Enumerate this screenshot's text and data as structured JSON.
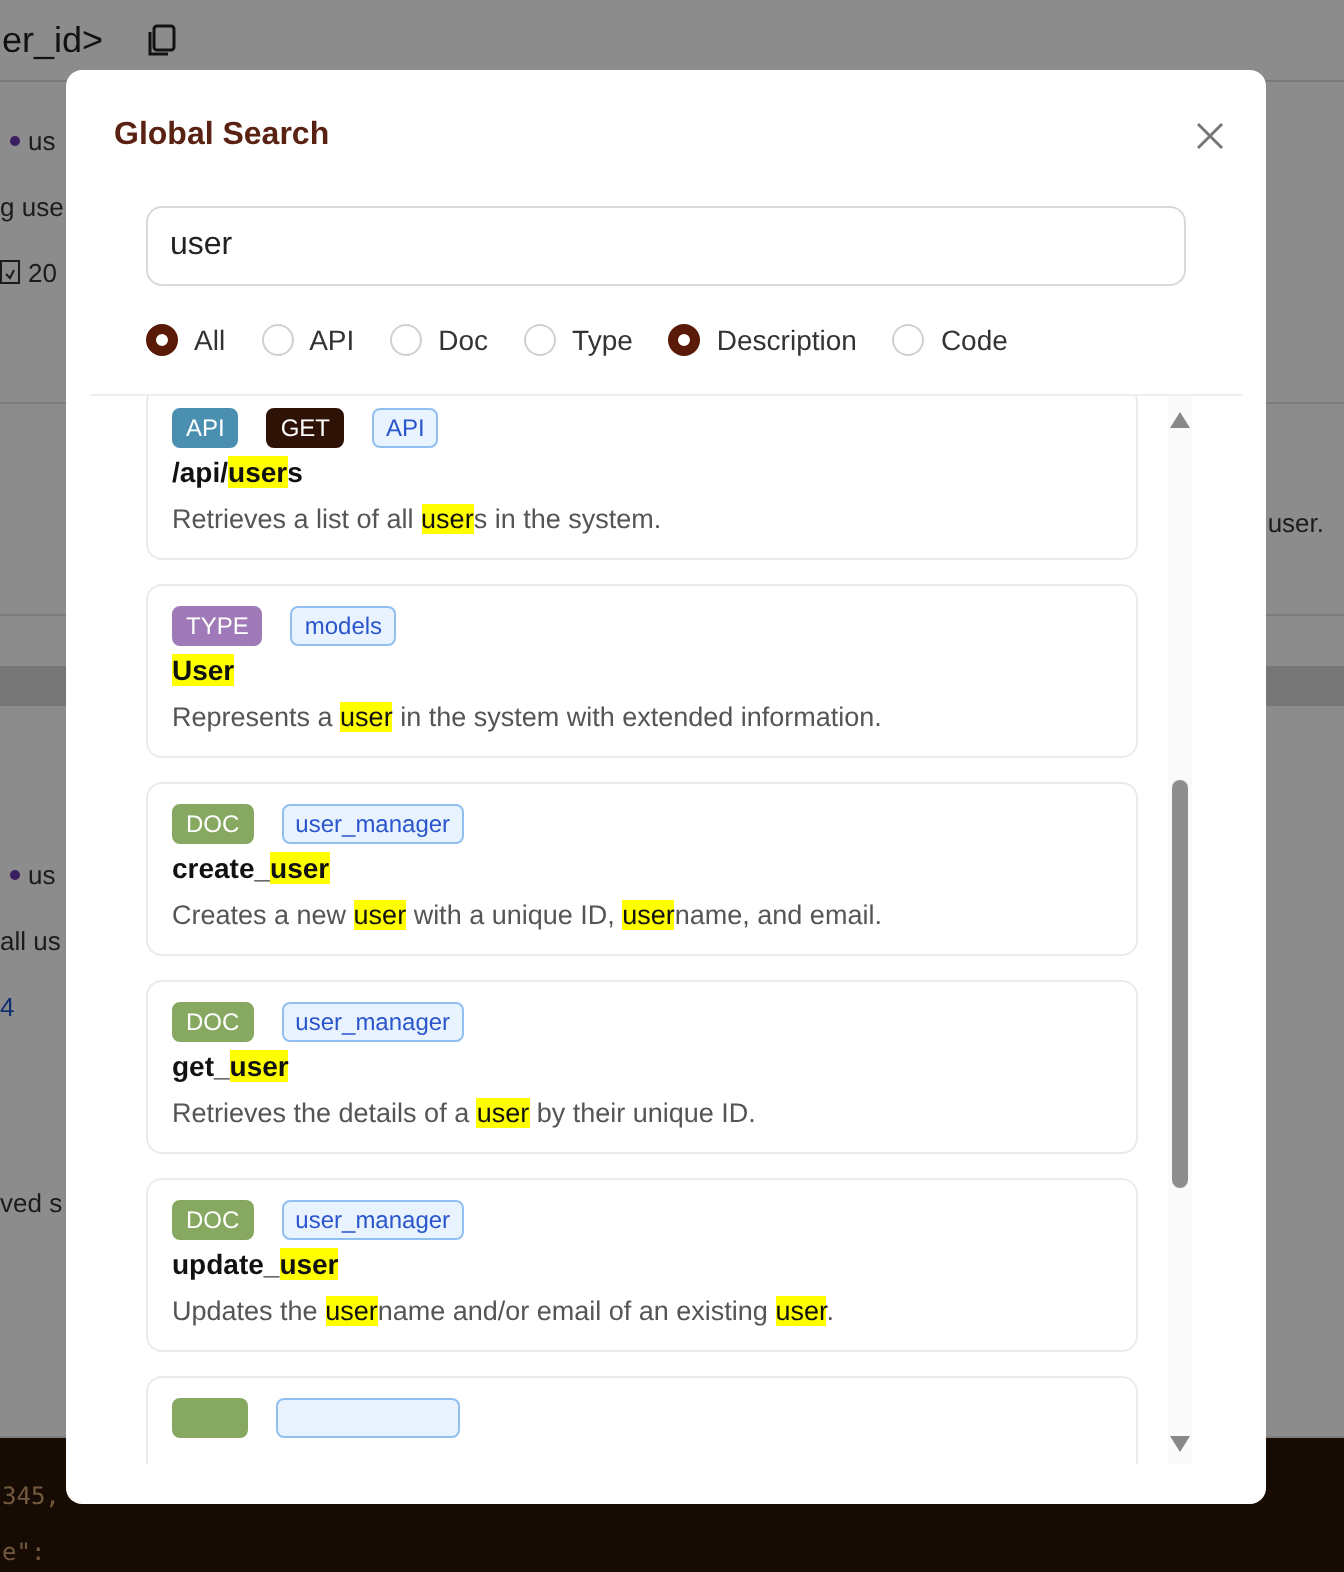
{
  "background": {
    "header": {
      "title": "er_id>"
    },
    "panel_1": {
      "lines": [
        {
          "kind": "bullet",
          "text": "us"
        },
        {
          "kind": "plain",
          "text": "g use"
        },
        {
          "kind": "status",
          "text": "20"
        }
      ]
    },
    "row": {
      "text": "user."
    },
    "panel_2": {
      "lines": [
        {
          "kind": "bullet",
          "text": "us"
        },
        {
          "kind": "plain",
          "text": "all us"
        },
        {
          "kind": "link",
          "text": "4"
        },
        {
          "kind": "plain",
          "text": "ved s"
        }
      ]
    },
    "code": {
      "lines": [
        "345,",
        "e\":"
      ]
    }
  },
  "dialog": {
    "title": "Global Search",
    "search": {
      "value": "user"
    },
    "filters": [
      {
        "label": "All",
        "selected": true
      },
      {
        "label": "API",
        "selected": false
      },
      {
        "label": "Doc",
        "selected": false
      },
      {
        "label": "Type",
        "selected": false
      },
      {
        "label": "Description",
        "selected": true
      },
      {
        "label": "Code",
        "selected": false
      }
    ],
    "results": [
      {
        "badges": [
          {
            "kind": "api",
            "text": "API"
          },
          {
            "kind": "method",
            "text": "GET"
          },
          {
            "kind": "tag",
            "text": "API"
          }
        ],
        "title": [
          {
            "text": "/api/"
          },
          {
            "text": "user",
            "match": true
          },
          {
            "text": "s"
          }
        ],
        "description": [
          {
            "text": "Retrieves a list of all "
          },
          {
            "text": "user",
            "match": true
          },
          {
            "text": "s in the system."
          }
        ]
      },
      {
        "badges": [
          {
            "kind": "type",
            "text": "TYPE"
          },
          {
            "kind": "tag",
            "text": "models"
          }
        ],
        "title": [
          {
            "text": "User",
            "match": true
          }
        ],
        "description": [
          {
            "text": "Represents a "
          },
          {
            "text": "user",
            "match": true
          },
          {
            "text": " in the system with extended information."
          }
        ]
      },
      {
        "badges": [
          {
            "kind": "doc",
            "text": "DOC"
          },
          {
            "kind": "tag",
            "text": "user_manager"
          }
        ],
        "title": [
          {
            "text": "create_"
          },
          {
            "text": "user",
            "match": true
          }
        ],
        "description": [
          {
            "text": "Creates a new "
          },
          {
            "text": "user",
            "match": true
          },
          {
            "text": " with a unique ID, "
          },
          {
            "text": "user",
            "match": true
          },
          {
            "text": "name, and email."
          }
        ]
      },
      {
        "badges": [
          {
            "kind": "doc",
            "text": "DOC"
          },
          {
            "kind": "tag",
            "text": "user_manager"
          }
        ],
        "title": [
          {
            "text": "get_"
          },
          {
            "text": "user",
            "match": true
          }
        ],
        "description": [
          {
            "text": "Retrieves the details of a "
          },
          {
            "text": "user",
            "match": true
          },
          {
            "text": " by their unique ID."
          }
        ]
      },
      {
        "badges": [
          {
            "kind": "doc",
            "text": "DOC"
          },
          {
            "kind": "tag",
            "text": "user_manager"
          }
        ],
        "title": [
          {
            "text": "update_"
          },
          {
            "text": "user",
            "match": true
          }
        ],
        "description": [
          {
            "text": "Updates the "
          },
          {
            "text": "user",
            "match": true
          },
          {
            "text": "name and/or email of an existing "
          },
          {
            "text": "user",
            "match": true
          },
          {
            "text": "."
          }
        ]
      },
      {
        "partial": true,
        "badges": [
          {
            "kind": "doc"
          },
          {
            "kind": "tag"
          }
        ]
      }
    ]
  }
}
